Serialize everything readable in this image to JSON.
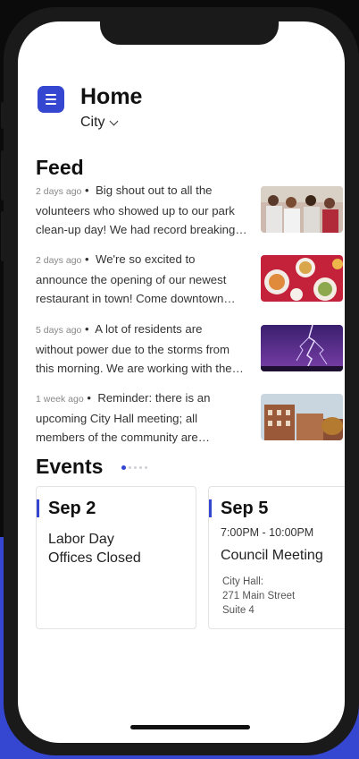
{
  "header": {
    "title": "Home",
    "location": "City"
  },
  "feed": {
    "heading": "Feed",
    "items": [
      {
        "time": "2 days ago",
        "line1": "Big shout out to all the",
        "line2": "volunteers who showed up to our park",
        "line3": "clean-up day! We had record breaking…",
        "image": "volunteers-photo"
      },
      {
        "time": "2 days ago",
        "line1": "We're so excited to",
        "line2": "announce the opening of our newest",
        "line3": "restaurant in town! Come downtown…",
        "image": "restaurant-food-photo"
      },
      {
        "time": "5 days ago",
        "line1": "A lot of residents are",
        "line2": "without power due to the storms from",
        "line3": "this morning. We are working with the…",
        "image": "lightning-storm-photo"
      },
      {
        "time": "1 week ago",
        "line1": "Reminder: there is an",
        "line2": "upcoming City Hall meeting; all",
        "line3": "members of the community are…",
        "image": "city-hall-photo"
      }
    ]
  },
  "events": {
    "heading": "Events",
    "pager_count": 5,
    "pager_active": 0,
    "cards": [
      {
        "date": "Sep 2",
        "title_line1": "Labor Day",
        "title_line2": "Offices Closed"
      },
      {
        "date": "Sep 5",
        "time": "7:00PM - 10:00PM",
        "title": "Council Meeting",
        "addr_line1": "City Hall:",
        "addr_line2": "271 Main Street",
        "addr_line3": "Suite 4"
      }
    ]
  },
  "colors": {
    "accent": "#3546d1",
    "background_band": "#3546d1"
  }
}
